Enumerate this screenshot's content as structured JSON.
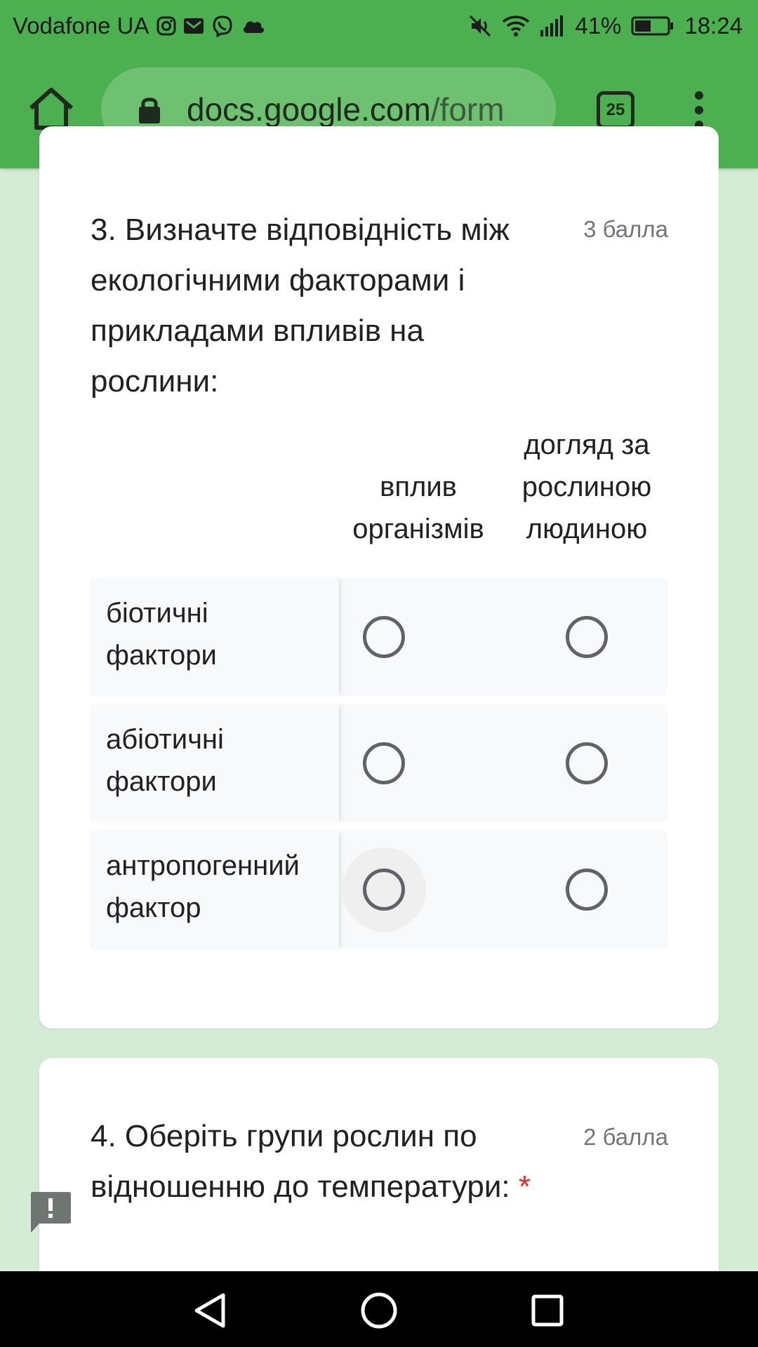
{
  "status_bar": {
    "carrier": "Vodafone UA",
    "battery": "41%",
    "time": "18:24",
    "left_icons": [
      "instagram-icon",
      "gmail-icon",
      "viber-icon",
      "cloud-icon"
    ],
    "right_icons": [
      "mute-icon",
      "wifi-icon",
      "signal-icon",
      "battery-icon"
    ]
  },
  "browser": {
    "url_host": "docs.google.com",
    "url_path": "/form",
    "tab_count": "25"
  },
  "question3": {
    "title": "3. Визначте відповідність між екологічними факторами і прикладами впливів на рослини:",
    "points": "3 балла",
    "columns": [
      {
        "line1": "вплив",
        "line2": "організмів"
      },
      {
        "line1": "догляд за",
        "line2": "рослиною",
        "line3": "людиною"
      }
    ],
    "rows": [
      {
        "line1": "біотичні",
        "line2": "фактори"
      },
      {
        "line1": "абіотичні",
        "line2": "фактори"
      },
      {
        "line1": "антропогенний",
        "line2": "фактор"
      }
    ]
  },
  "question4": {
    "title": "4. Оберіть групи рослин по відношенню до температури:",
    "required_mark": "*",
    "points": "2 балла"
  },
  "colors": {
    "toolbar": "#4caf50",
    "omnibox": "#6dc170",
    "page_background": "#d4ecd5",
    "required": "#d93025"
  }
}
